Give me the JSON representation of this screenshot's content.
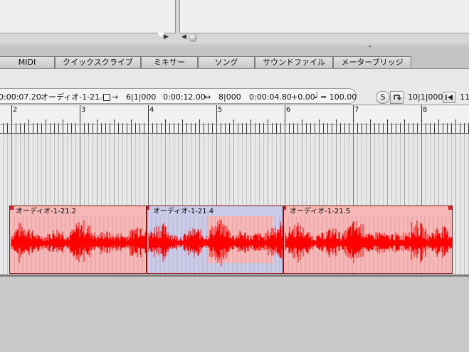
{
  "tabs": [
    {
      "label": "MIDI"
    },
    {
      "label": "クイックスクライブ"
    },
    {
      "label": "ミキサー"
    },
    {
      "label": "ソング"
    },
    {
      "label": "サウンドファイル"
    },
    {
      "label": "メーターブリッジ"
    }
  ],
  "info": {
    "time_start": "0:00:07.20",
    "region_name": "オーディオ-1-21.4",
    "arrow_right": "→",
    "start_pos": "6|1|000",
    "time_end": "0:00:12.00",
    "length_icon": "↔",
    "length_pos": "8|000",
    "duration": "0:00:04.80",
    "offset": "+0.00",
    "note_glyph": "♩",
    "tempo": "= 100.00"
  },
  "transport": {
    "s_label": "S",
    "loop_icon": "loop-back-icon",
    "locator_pos": "10|1|000",
    "back_icon": "back-to-start-icon",
    "overflow_text": "11"
  },
  "ruler": {
    "bars": [
      "2",
      "3",
      "4",
      "5",
      "6",
      "7",
      "8"
    ]
  },
  "clips": [
    {
      "name": "オーディオ-1-21.2",
      "selected": false
    },
    {
      "name": "オーディオ-1-21.4",
      "selected": true
    },
    {
      "name": "オーディオ-1-21.5",
      "selected": false
    }
  ],
  "colors": {
    "waveform": "#ff0000",
    "clip_fill": "#f6b7b7",
    "clip_selected_fill": "#c9cbe8",
    "clip_marker": "#d42020"
  },
  "glyphs": {
    "scroll_left": "◀",
    "scroll_right": "▶",
    "collapse_up": "▲"
  }
}
